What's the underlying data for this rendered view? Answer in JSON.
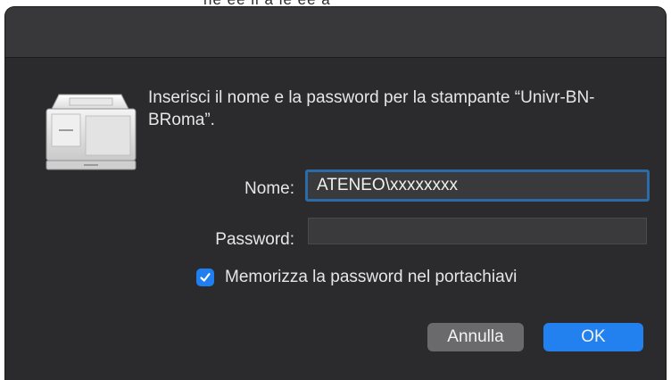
{
  "backdrop": {
    "partial_text": "ne   ee ll a ie  ee a"
  },
  "dialog": {
    "message": "Inserisci il nome e la password per la stampante “Univr-BN-BRoma”.",
    "name_label": "Nome:",
    "name_value": "ATENEO\\xxxxxxxx",
    "password_label": "Password:",
    "password_value": "",
    "remember_label": "Memorizza la password nel portachiavi",
    "remember_checked": true,
    "cancel_label": "Annulla",
    "ok_label": "OK"
  },
  "icons": {
    "printer": "printer-icon",
    "checkmark": "checkmark-icon"
  },
  "colors": {
    "accent": "#2380ef",
    "focus_ring": "#2b6ca8",
    "background": "#2b2b2d",
    "text": "#e6e6e6"
  }
}
